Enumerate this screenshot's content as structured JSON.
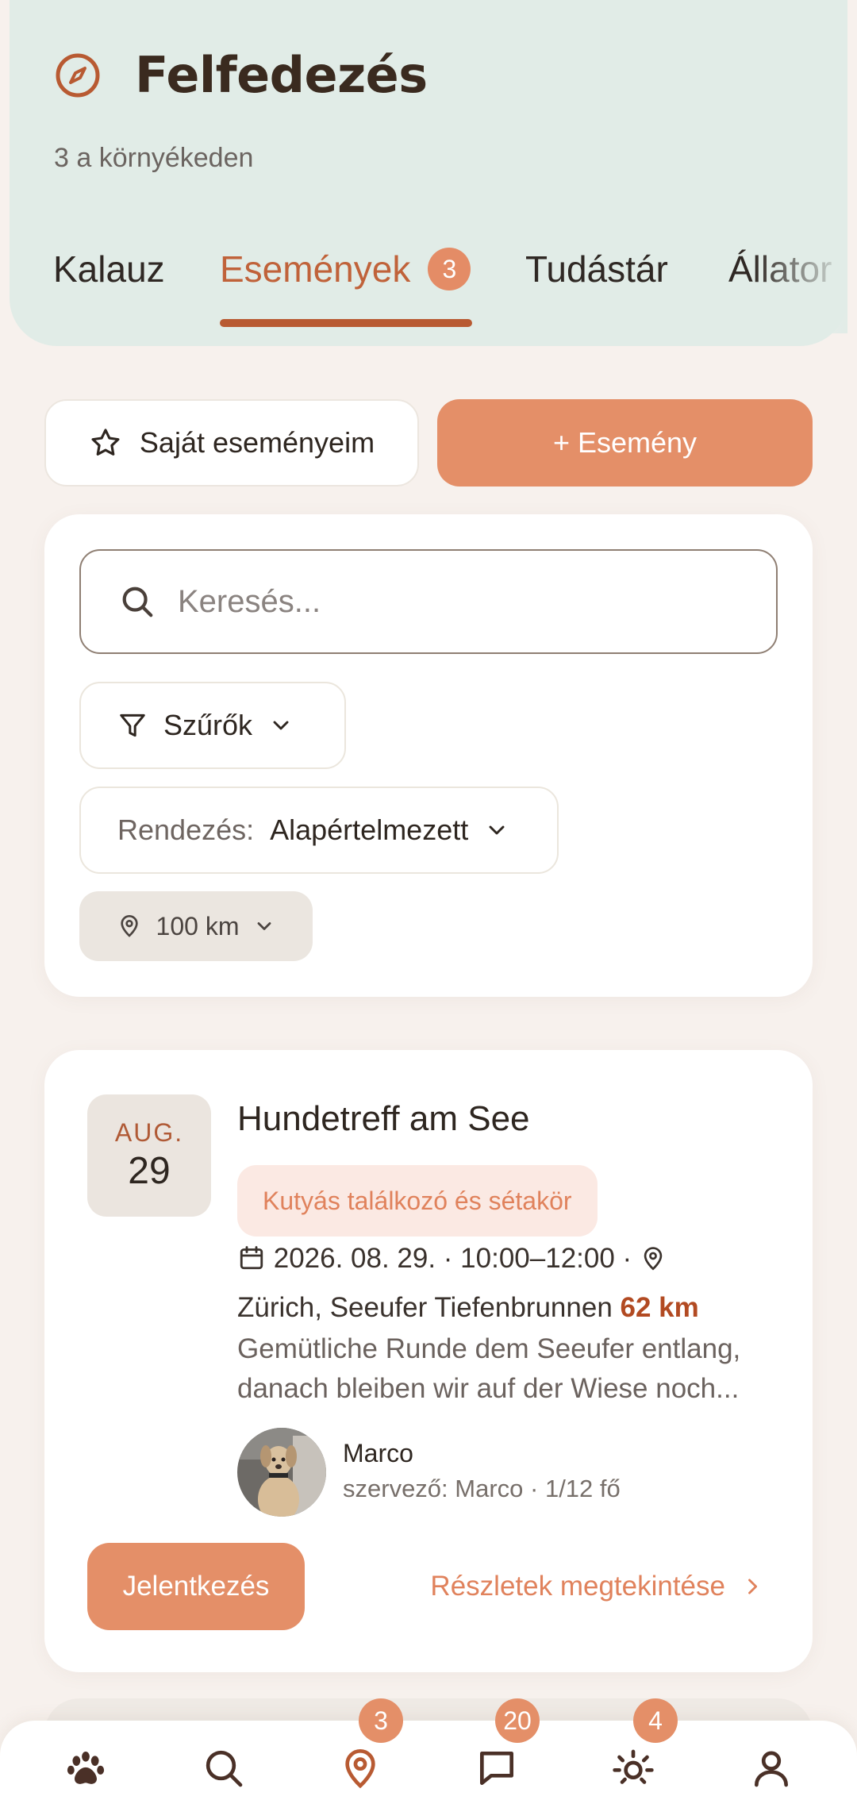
{
  "header": {
    "title": "Felfedezés",
    "subtitle": "3 a környékeden"
  },
  "tabs": [
    {
      "label": "Kalauz"
    },
    {
      "label": "Események",
      "badge": "3",
      "active": true
    },
    {
      "label": "Tudástár"
    },
    {
      "label": "Állator"
    }
  ],
  "actions": {
    "my_events": "Saját eseményeim",
    "new_event": "+ Esemény"
  },
  "search": {
    "placeholder": "Keresés..."
  },
  "filters": {
    "filters_label": "Szűrők",
    "sort_label": "Rendezés:",
    "sort_value": "Alapértelmezett",
    "distance": "100 km"
  },
  "event": {
    "month": "AUG.",
    "day": "29",
    "title": "Hundetreff am See",
    "tag": "Kutyás találkozó és sétakör",
    "datetime": "2026. 08. 29. · 10:00–12:00 ·",
    "location": "Zürich, Seeufer Tiefenbrunnen",
    "distance": "62 km",
    "description": "Gemütliche Runde dem Seeufer entlang, danach bleiben wir auf der Wiese noch...",
    "organizer_name": "Marco",
    "organizer_sub": "szervező: Marco · 1/12 fő",
    "join_label": "Jelentkezés",
    "details_label": "Részletek megtekintése"
  },
  "bottom_nav": [
    {
      "icon": "paw-icon"
    },
    {
      "icon": "search-icon"
    },
    {
      "icon": "map-pin-icon",
      "badge": "3"
    },
    {
      "icon": "chat-icon",
      "badge": "20"
    },
    {
      "icon": "sun-icon",
      "badge": "4"
    },
    {
      "icon": "user-icon"
    }
  ],
  "colors": {
    "accent": "#e48f68",
    "accent_dark": "#b85a32",
    "header_bg": "#e1ece7"
  }
}
